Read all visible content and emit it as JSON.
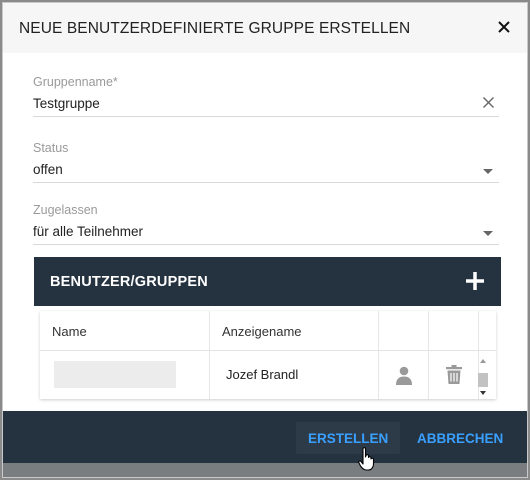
{
  "dialog": {
    "title": "NEUE BENUTZERDEFINIERTE GRUPPE ERSTELLEN",
    "close_icon": "close-icon"
  },
  "form": {
    "group_name": {
      "label": "Gruppenname*",
      "value": "Testgruppe"
    },
    "status": {
      "label": "Status",
      "value": "offen"
    },
    "allowed": {
      "label": "Zugelassen",
      "value": "für alle Teilnehmer"
    }
  },
  "panel": {
    "title": "BENUTZER/GRUPPEN",
    "add_icon": "plus-icon"
  },
  "table": {
    "columns": [
      "Name",
      "Anzeigename",
      "",
      "",
      ""
    ],
    "rows": [
      {
        "name": "",
        "display_name": "Jozef Brandl",
        "user_icon": "user-icon",
        "delete_icon": "trash-icon"
      }
    ]
  },
  "footer": {
    "create_label": "ERSTELLEN",
    "cancel_label": "ABBRECHEN"
  },
  "colors": {
    "header_bg": "#f6f6f6",
    "dark_bar": "#25323f",
    "accent_blue": "#3aa0ff"
  }
}
